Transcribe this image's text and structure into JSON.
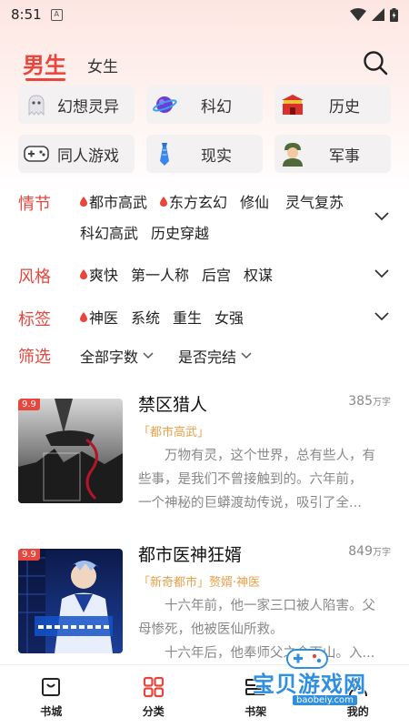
{
  "status_bar": {
    "time": "8:51",
    "a_icon": "A"
  },
  "header": {
    "tab_male": "男生",
    "tab_female": "女生"
  },
  "categories": [
    {
      "label": "幻想灵异",
      "icon": "ghost-icon"
    },
    {
      "label": "科幻",
      "icon": "planet-icon"
    },
    {
      "label": "历史",
      "icon": "palace-icon"
    },
    {
      "label": "同人游戏",
      "icon": "gamepad-icon"
    },
    {
      "label": "现实",
      "icon": "tie-icon"
    },
    {
      "label": "军事",
      "icon": "soldier-icon"
    }
  ],
  "filters": [
    {
      "title": "情节",
      "items": [
        {
          "label": "都市高武",
          "hot": true
        },
        {
          "label": "东方玄幻",
          "hot": true
        },
        {
          "label": "修仙",
          "hot": false
        },
        {
          "label": "灵气复苏",
          "hot": false
        },
        {
          "label": "科幻高武",
          "hot": false
        },
        {
          "label": "历史穿越",
          "hot": false
        }
      ]
    },
    {
      "title": "风格",
      "items": [
        {
          "label": "爽快",
          "hot": true
        },
        {
          "label": "第一人称",
          "hot": false
        },
        {
          "label": "后宫",
          "hot": false
        },
        {
          "label": "权谋",
          "hot": false
        }
      ]
    },
    {
      "title": "标签",
      "items": [
        {
          "label": "神医",
          "hot": true
        },
        {
          "label": "系统",
          "hot": false
        },
        {
          "label": "重生",
          "hot": false
        },
        {
          "label": "女强",
          "hot": false
        }
      ]
    }
  ],
  "sort": {
    "title": "筛选",
    "word_count": "全部字数",
    "completion": "是否完结"
  },
  "books": [
    {
      "score": "9.9",
      "title": "禁区猎人",
      "words": "385",
      "words_unit": "万字",
      "tag_main": "「都市高武」",
      "tag_extra": "",
      "desc_lines": [
        "万物有灵，这个世界，总有些人，有",
        "些事，是我们不曾接触到的。六年前，",
        "一个神秘的巨蟒渡劫传说，吸引了全..."
      ]
    },
    {
      "score": "9.9",
      "title": "都市医神狂婿",
      "words": "849",
      "words_unit": "万字",
      "tag_main": "「新奇都市」",
      "tag_extra": "赘婿·神医",
      "desc_lines": [
        "十六年前，他一家三口被人陷害。父",
        "母惨死，他被医仙所救。",
        "十六年后，他奉师父之命下山。入..."
      ]
    }
  ],
  "bottom_nav": [
    {
      "label": "书城",
      "icon": "bookstore-icon"
    },
    {
      "label": "分类",
      "icon": "category-icon"
    },
    {
      "label": "书架",
      "icon": "bookshelf-icon"
    },
    {
      "label": "我的",
      "icon": "profile-icon"
    }
  ],
  "watermark": {
    "main": "宝贝游戏网",
    "sub": "baobeiy.com"
  },
  "colors": {
    "accent": "#e8453c",
    "tag": "#e8a04a",
    "watermark": "#2f8fe0"
  }
}
